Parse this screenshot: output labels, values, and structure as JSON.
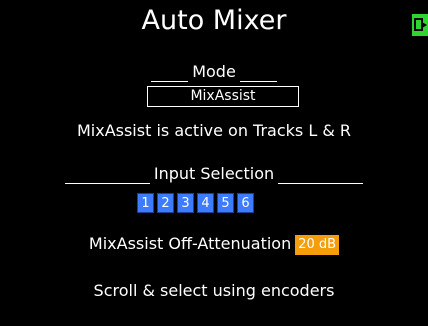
{
  "screen": {
    "title": "Auto Mixer",
    "battery_icon": "battery-icon",
    "colors": {
      "background": "#000000",
      "text": "#ffffff",
      "track_button": "#3d7cff",
      "value_highlight": "#f59d0a",
      "battery": "#2ed52e"
    }
  },
  "mode": {
    "heading": "Mode",
    "value": "MixAssist"
  },
  "status": {
    "text": "MixAssist is active on Tracks L & R"
  },
  "input_selection": {
    "heading": "Input Selection",
    "tracks": [
      "1",
      "2",
      "3",
      "4",
      "5",
      "6"
    ]
  },
  "attenuation": {
    "label": "MixAssist Off-Attenuation",
    "value": "20 dB"
  },
  "hint": {
    "text": "Scroll & select using encoders"
  }
}
